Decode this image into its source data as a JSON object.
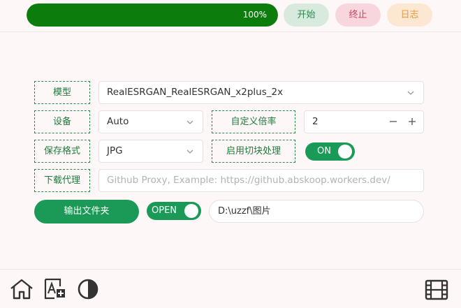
{
  "topbar": {
    "progress": {
      "value": 1.0,
      "text": "100%"
    },
    "start_label": "开始",
    "stop_label": "终止",
    "log_label": "日志"
  },
  "form": {
    "model": {
      "label": "模型",
      "value": "RealESRGAN_RealESRGAN_x2plus_2x"
    },
    "device": {
      "label": "设备",
      "value": "Auto"
    },
    "custom_scale": {
      "label": "自定义倍率",
      "value": "2"
    },
    "format": {
      "label": "保存格式",
      "value": "JPG"
    },
    "tiling": {
      "label": "启用切块处理",
      "toggle_text": "ON"
    },
    "proxy": {
      "label": "下载代理",
      "value": "",
      "placeholder": "Github Proxy, Example: https://github.abskoop.workers.dev/"
    },
    "output": {
      "button_label": "输出文件夹",
      "toggle_text": "OPEN",
      "path": "D:\\uzzf\\图片"
    }
  },
  "bottombar": {
    "icons": [
      "home-icon",
      "font-icon",
      "contrast-icon",
      "film-icon"
    ]
  },
  "colors": {
    "accent": "#1a9a56",
    "progress": "#0c7d0c",
    "label_border": "#2c8a4a"
  }
}
